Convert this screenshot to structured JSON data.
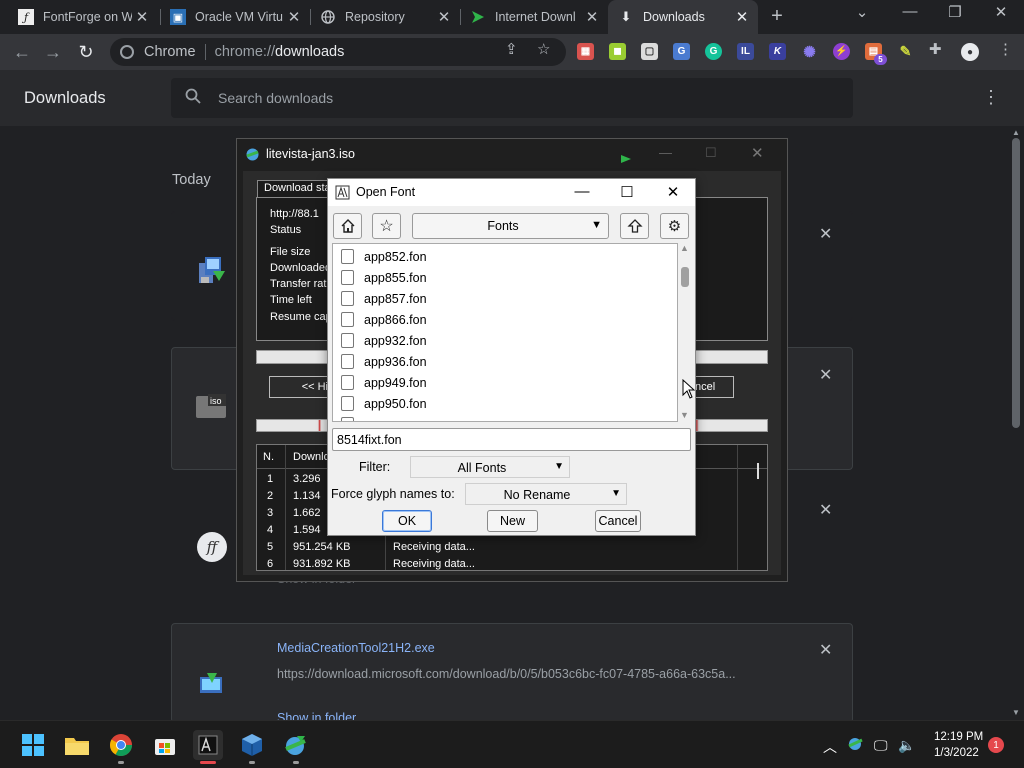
{
  "tabs": [
    {
      "title": "FontForge on W",
      "icon": "fontforge-icon"
    },
    {
      "title": "Oracle VM Virtu",
      "icon": "virtualbox-icon"
    },
    {
      "title": "Repository",
      "icon": "globe-icon"
    },
    {
      "title": "Internet Downl",
      "icon": "idm-flag-icon"
    },
    {
      "title": "Downloads",
      "icon": "download-icon",
      "active": true
    }
  ],
  "toolbar": {
    "omnibox_label": "Chrome",
    "url_prefix": "chrome://",
    "url_path": "downloads"
  },
  "downloads_page": {
    "title": "Downloads",
    "search_placeholder": "Search downloads",
    "section": "Today",
    "card3_show": "Show in folder",
    "card4": {
      "filename": "MediaCreationTool21H2.exe",
      "url": "https://download.microsoft.com/download/b/0/5/b053c6bc-fc07-4785-a66a-63c5a...",
      "show_in_folder": "Show in folder"
    },
    "ff_letters": "ff"
  },
  "idm_dialog": {
    "title": "litevista-jan3.iso",
    "tab_label": "Download status",
    "url_fragment": "http://88.1",
    "status_label": "Status",
    "fields": [
      "File size",
      "Downloaded",
      "Transfer rate",
      "Time left",
      "Resume capability"
    ],
    "hide_btn": "<< Hi",
    "cancel_btn": "ncel",
    "table_headers": [
      "N.",
      "Downlo"
    ],
    "rows": [
      {
        "n": "1",
        "downloaded": "3.296",
        "info": ""
      },
      {
        "n": "2",
        "downloaded": "1.134",
        "info": ""
      },
      {
        "n": "3",
        "downloaded": "1.662",
        "info": ""
      },
      {
        "n": "4",
        "downloaded": "1.594",
        "info": ""
      },
      {
        "n": "5",
        "downloaded": "951.254  KB",
        "info": "Receiving data..."
      },
      {
        "n": "6",
        "downloaded": "931.892  KB",
        "info": "Receiving data..."
      }
    ]
  },
  "open_font": {
    "title": "Open Font",
    "location": "Fonts",
    "files": [
      "app852.fon",
      "app855.fon",
      "app857.fon",
      "app866.fon",
      "app932.fon",
      "app936.fon",
      "app949.fon",
      "app950.fon"
    ],
    "path_value": "8514fixt.fon",
    "filter_label": "Filter:",
    "filter_value": "All Fonts",
    "glyph_label": "Force glyph names to:",
    "glyph_value": "No Rename",
    "ok": "OK",
    "new": "New",
    "cancel": "Cancel"
  },
  "taskbar": {
    "time": "12:19 PM",
    "date": "1/3/2022",
    "notifications": "1"
  },
  "extensions_badge": "5",
  "colors": {
    "chrome_bg": "#202124",
    "chrome_toolbar": "#35363a",
    "link_blue": "#8ab4f8",
    "dialog_bg": "#f0f0f0",
    "notification_red": "#e5484d"
  }
}
